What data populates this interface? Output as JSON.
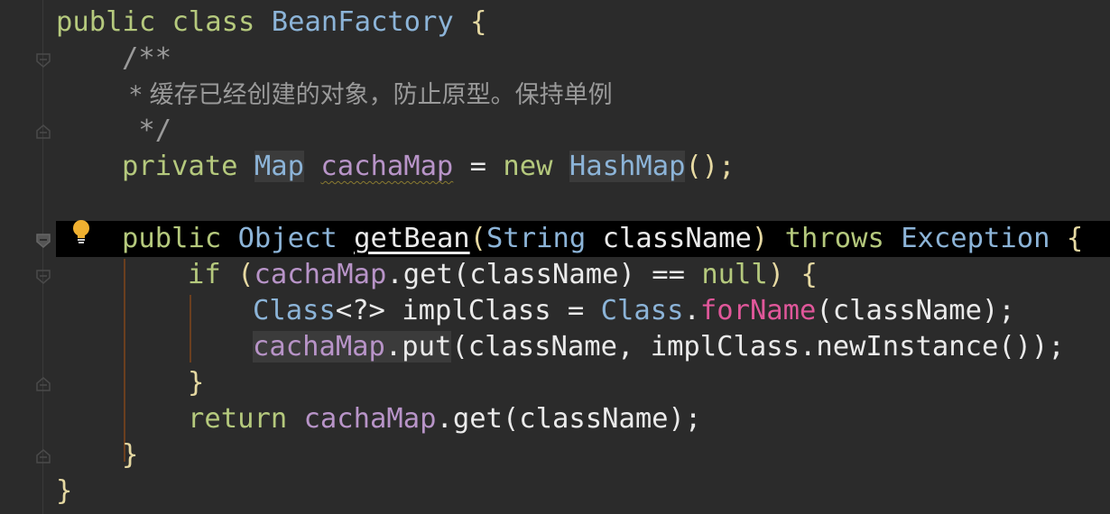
{
  "code": {
    "l1": {
      "kw1": "public",
      "kw2": "class",
      "name": "BeanFactory",
      "brace": "{"
    },
    "l2": {
      "text": "/**"
    },
    "l3": {
      "text": " * 缓存已经创建的对象，防止原型。保持单例"
    },
    "l4": {
      "text": " */"
    },
    "l5": {
      "kw": "private",
      "type": "Map",
      "field": "cachaMap",
      "eq": "=",
      "kw2": "new",
      "type2": "HashMap",
      "rest": "();"
    },
    "l7": {
      "kw": "public",
      "type": "Object",
      "method": "getBean",
      "open": "(",
      "ptype": "String",
      "pname": "className",
      "close": ")",
      "throws": "throws",
      "exc": "Exception",
      "brace": "{"
    },
    "l8": {
      "kw": "if",
      "open": "(",
      "field": "cachaMap",
      "call": ".get(",
      "arg": "className",
      "mid": ") == ",
      "nul": "null",
      "end": ") {"
    },
    "l9": {
      "type": "Class",
      "gen": "<?>",
      "var": "implClass",
      "eq": " = ",
      "type2": "Class",
      "dot": ".",
      "method": "forName",
      "rest": "(className);"
    },
    "l10": {
      "field": "cachaMap",
      "call": ".put",
      "rest": "(className, implClass.newInstance());"
    },
    "l11": {
      "brace": "}"
    },
    "l12": {
      "kw": "return",
      "field": "cachaMap",
      "rest": ".get(className);"
    },
    "l13": {
      "brace": "}"
    },
    "l14": {
      "brace": "}"
    }
  },
  "icons": {
    "gutter": "fold-marker-icon",
    "bulb": "lightbulb-icon"
  },
  "colors": {
    "background": "#2b2b2b",
    "keyword": "#b5c97d",
    "class": "#8cb4d8",
    "field": "#b894c8",
    "comment": "#9a9a9a",
    "static_method": "#e0579a",
    "current_line": "#000000"
  }
}
